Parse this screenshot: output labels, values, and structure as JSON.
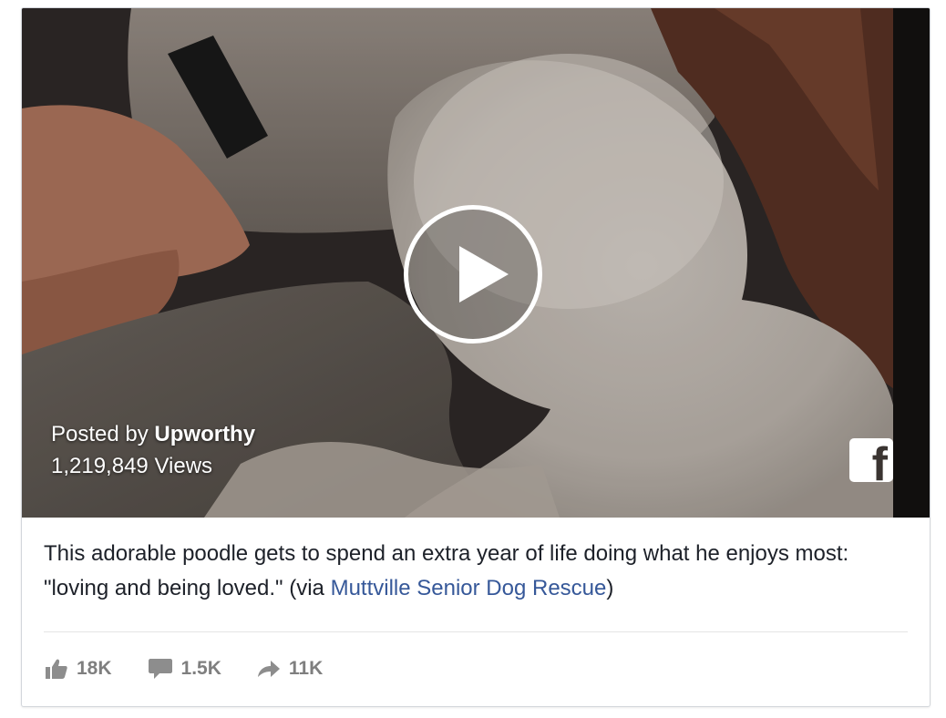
{
  "video": {
    "posted_by_prefix": "Posted by",
    "author": "Upworthy",
    "views": "1,219,849 Views",
    "play_icon": "play-icon",
    "platform_icon": "facebook-logo-icon",
    "platform_glyph": "f"
  },
  "post": {
    "caption_text": "This adorable poodle gets to spend an extra year of life doing what he enjoys most: \"loving and being loved.\" (via ",
    "caption_link": "Muttville Senior Dog Rescue",
    "caption_end": ")"
  },
  "stats": {
    "likes": "18K",
    "comments": "1.5K",
    "shares": "11K",
    "like_icon": "thumbs-up-icon",
    "comment_icon": "comment-bubble-icon",
    "share_icon": "share-arrow-icon"
  },
  "colors": {
    "link": "#365899",
    "stat_text": "#7f7f7f",
    "body_text": "#1d2129"
  }
}
